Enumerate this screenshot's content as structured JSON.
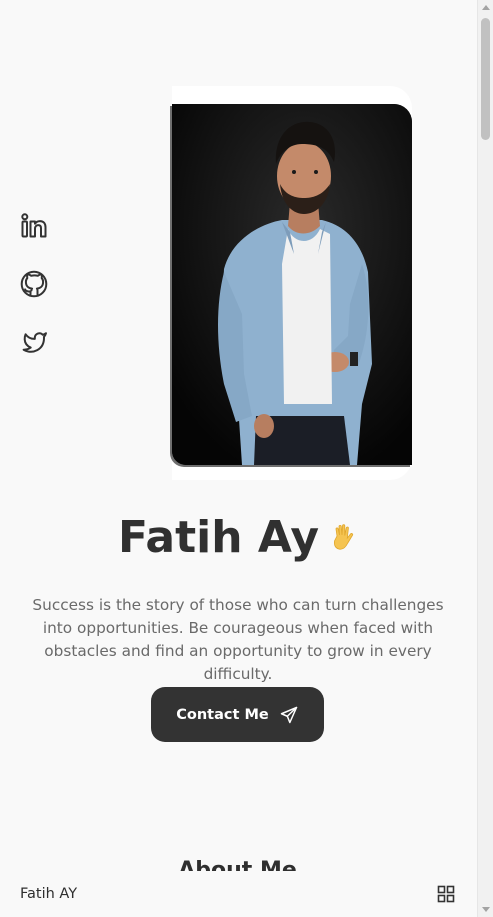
{
  "hero": {
    "name": "Fatih Ay",
    "wave_emoji": "wave-hand-icon",
    "tagline": "Success is the story of those who can turn challenges into opportunities. Be courageous when faced with obstacles and find an opportunity to grow in every difficulty.",
    "contact_label": "Contact Me",
    "contact_icon": "send-icon"
  },
  "social": {
    "items": [
      {
        "icon": "linkedin-icon"
      },
      {
        "icon": "github-icon"
      },
      {
        "icon": "twitter-icon"
      }
    ]
  },
  "sections": {
    "about_title": "About Me"
  },
  "nav": {
    "brand": "Fatih AY",
    "menu_icon": "grid-menu-icon"
  },
  "colors": {
    "background": "#f9f9f9",
    "text": "#2f2f2f",
    "muted": "#6a6a6a",
    "button": "#333333",
    "accent": "#f5c451"
  }
}
